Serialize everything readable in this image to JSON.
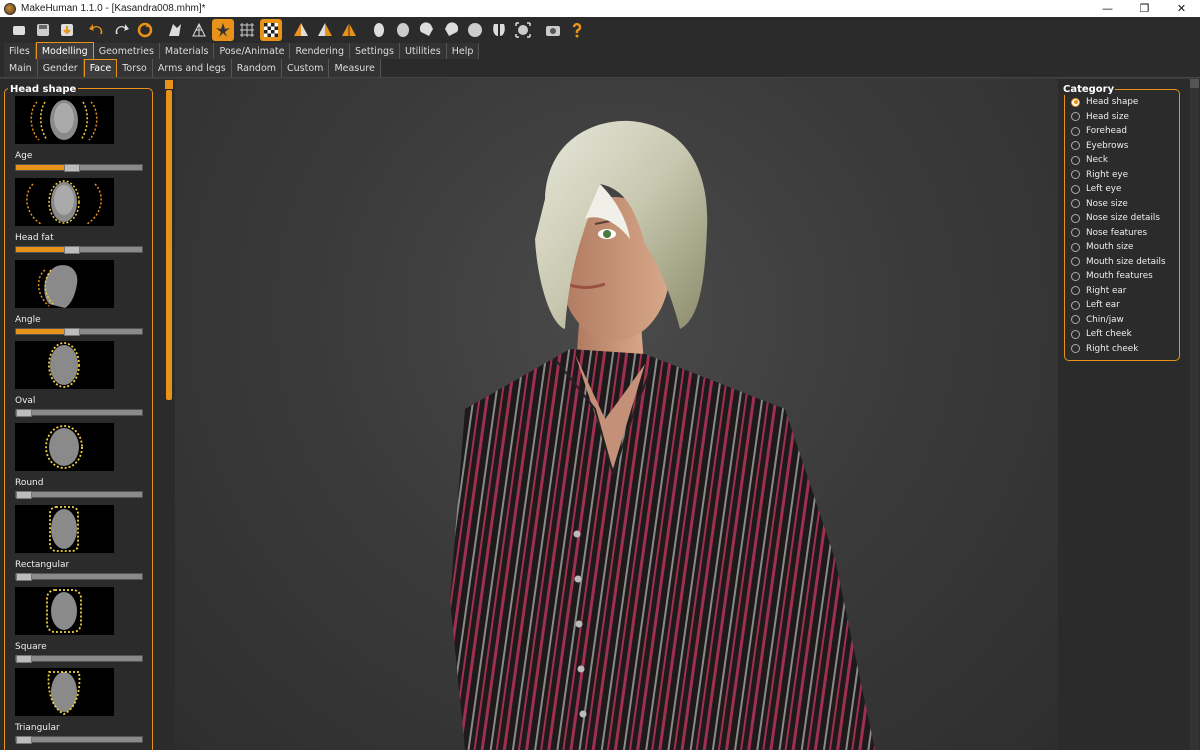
{
  "window": {
    "title": "MakeHuman 1.1.0 - [Kasandra008.mhm]*",
    "minimize": "—",
    "restore": "❐",
    "close": "✕"
  },
  "toolbar": {
    "icons": [
      "new-file-icon",
      "save-icon",
      "export-icon",
      "undo-icon",
      "redo-icon",
      "reset-icon",
      "smooth-icon",
      "wireframe-icon",
      "pose-icon",
      "grid-icon",
      "background-icon",
      "front-view-icon",
      "side-view-icon",
      "back-view-icon",
      "head-view-icon",
      "torso-view-icon",
      "left-view-icon",
      "right-view-icon",
      "top-view-icon",
      "bottom-view-icon",
      "reset-camera-icon",
      "screenshot-icon",
      "help-icon"
    ]
  },
  "tabs_main": [
    {
      "label": "Files",
      "active": false
    },
    {
      "label": "Modelling",
      "active": true
    },
    {
      "label": "Geometries",
      "active": false
    },
    {
      "label": "Materials",
      "active": false
    },
    {
      "label": "Pose/Animate",
      "active": false
    },
    {
      "label": "Rendering",
      "active": false
    },
    {
      "label": "Settings",
      "active": false
    },
    {
      "label": "Utilities",
      "active": false
    },
    {
      "label": "Help",
      "active": false
    }
  ],
  "tabs_sub": [
    {
      "label": "Main",
      "active": false
    },
    {
      "label": "Gender",
      "active": false
    },
    {
      "label": "Face",
      "active": true
    },
    {
      "label": "Torso",
      "active": false
    },
    {
      "label": "Arms and legs",
      "active": false
    },
    {
      "label": "Random",
      "active": false
    },
    {
      "label": "Custom",
      "active": false
    },
    {
      "label": "Measure",
      "active": false
    }
  ],
  "left_panel": {
    "title": "Head shape",
    "sliders": [
      {
        "label": "Age",
        "value": 0.5
      },
      {
        "label": "Head fat",
        "value": 0.5
      },
      {
        "label": "Angle",
        "value": 0.5
      },
      {
        "label": "Oval",
        "value": 0.0
      },
      {
        "label": "Round",
        "value": 0.0
      },
      {
        "label": "Rectangular",
        "value": 0.0
      },
      {
        "label": "Square",
        "value": 0.0
      },
      {
        "label": "Triangular",
        "value": 0.0
      }
    ]
  },
  "right_panel": {
    "title": "Category",
    "selected": "Head shape",
    "items": [
      "Head shape",
      "Head size",
      "Forehead",
      "Eyebrows",
      "Neck",
      "Right eye",
      "Left eye",
      "Nose size",
      "Nose size details",
      "Nose features",
      "Mouth size",
      "Mouth size details",
      "Mouth features",
      "Right ear",
      "Left ear",
      "Chin/jaw",
      "Left cheek",
      "Right cheek"
    ]
  },
  "colors": {
    "accent": "#e8921a",
    "panel": "#2b2b2b",
    "highlight_dash": "#f0d040"
  }
}
